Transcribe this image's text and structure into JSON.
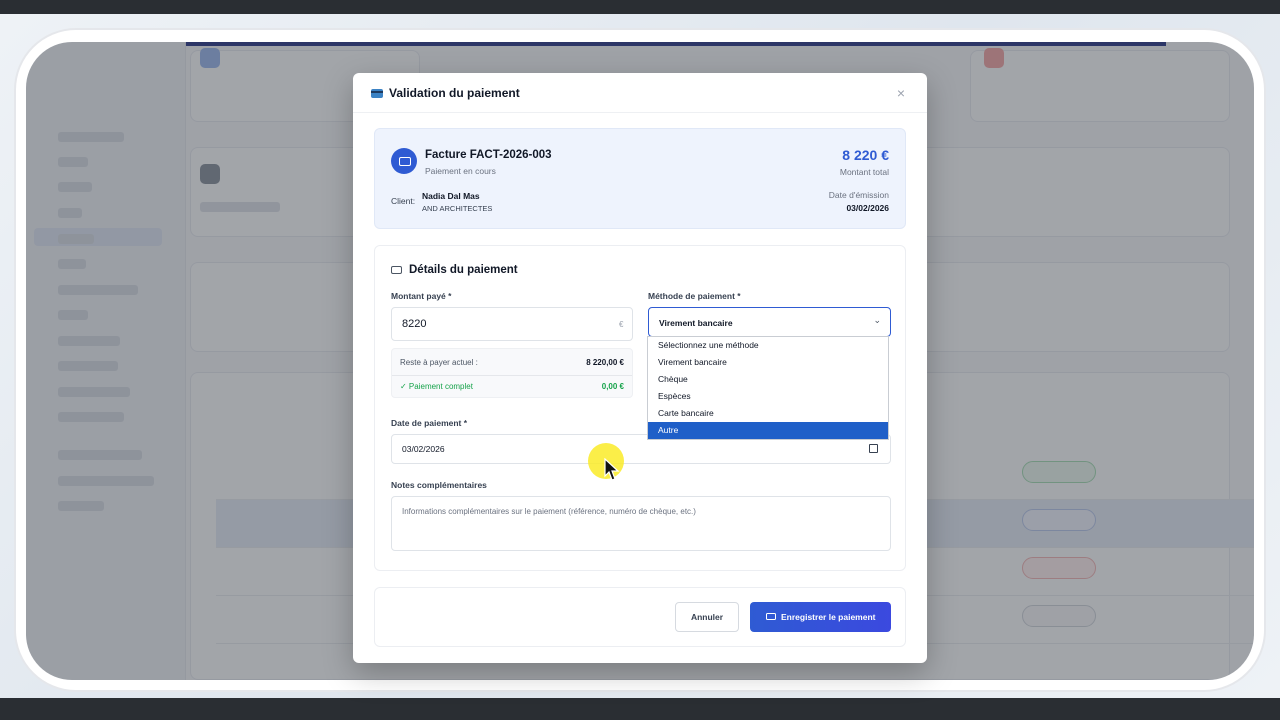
{
  "modal": {
    "title": "Validation du paiement",
    "close_icon": "×"
  },
  "invoice": {
    "title": "Facture FACT-2026-003",
    "status": "Paiement en cours",
    "amount": "8 220 €",
    "amount_label": "Montant total",
    "client_label": "Client:",
    "client_name": "Nadia Dal Mas",
    "client_company": "AND ARCHITECTES",
    "date_label": "Date d'émission",
    "date": "03/02/2026"
  },
  "details": {
    "title": "Détails du paiement",
    "amount_label": "Montant payé *",
    "amount_value": "8220",
    "currency_suffix": "€",
    "remaining_label": "Reste à payer actuel :",
    "remaining_value": "8 220,00 €",
    "complete_label": "✓ Paiement complet",
    "complete_value": "0,00 €",
    "method_label": "Méthode de paiement *",
    "method_value": "Virement bancaire",
    "method_options": [
      "Sélectionnez une méthode",
      "Virement bancaire",
      "Chèque",
      "Espèces",
      "Carte bancaire",
      "Autre"
    ],
    "highlighted_option": "Autre",
    "date_label": "Date de paiement *",
    "date_value": "03/02/2026",
    "notes_label": "Notes complémentaires",
    "notes_placeholder": "Informations complémentaires sur le paiement (référence, numéro de chèque, etc.)"
  },
  "footer": {
    "cancel_label": "Annuler",
    "save_label": "Enregistrer le paiement"
  },
  "colors": {
    "accent": "#2f5bd3",
    "success": "#16a34a",
    "highlight": "#1f5fc8"
  },
  "icons": {
    "header": "credit-card-icon",
    "invoice": "invoice-icon",
    "details": "credit-card-icon",
    "calendar": "calendar-icon",
    "save": "credit-card-icon",
    "chevron": "chevron-down-icon",
    "close": "close-icon"
  }
}
